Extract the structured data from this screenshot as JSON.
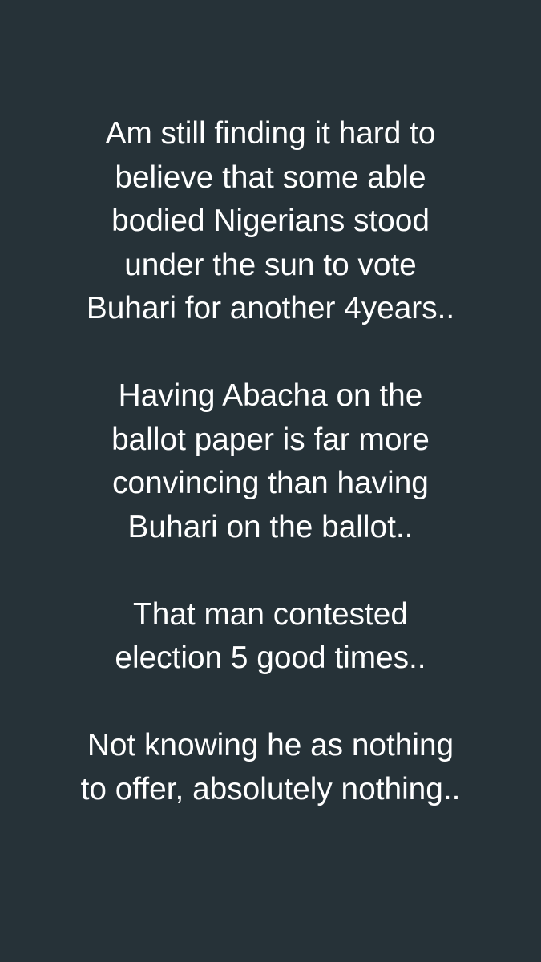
{
  "background_color": "#263238",
  "text_color": "#ffffff",
  "paragraphs": [
    {
      "lines": [
        "Am still finding it hard to",
        "believe that some able",
        "bodied Nigerians stood",
        "under the sun to vote",
        "Buhari for another 4years.."
      ]
    },
    {
      "lines": [
        "Having Abacha on the",
        "ballot paper is far more",
        "convincing than having",
        "Buhari on the ballot.."
      ]
    },
    {
      "lines": [
        "That man contested",
        "election 5 good times.."
      ]
    },
    {
      "lines": [
        "Not knowing he as nothing",
        "to offer, absolutely nothing.."
      ]
    }
  ]
}
